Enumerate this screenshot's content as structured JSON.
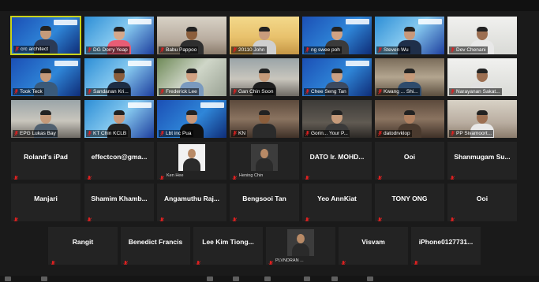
{
  "colors": {
    "background": "#1a1a1a",
    "tile": "#232323",
    "active_border": "#c9d21a",
    "muted": "#e02020"
  },
  "video_tiles": [
    {
      "name": "crc architect",
      "banner": ""
    },
    {
      "name": "DG Dorry Yeap",
      "banner": "Hi"
    },
    {
      "name": "Babu Pappoo",
      "banner": ""
    },
    {
      "name": "20110 John",
      "banner": ""
    },
    {
      "name": "ng swee poh",
      "banner": ""
    },
    {
      "name": "Steven Wu",
      "banner": ""
    },
    {
      "name": "Dev Chenani",
      "banner": ""
    },
    {
      "name": "Took Teck",
      "banner": ""
    },
    {
      "name": "Sandanan Kri...",
      "banner": "20"
    },
    {
      "name": "Frederick Lee",
      "banner": ""
    },
    {
      "name": "Gan Chin Soon",
      "banner": ""
    },
    {
      "name": "Chee Seng Tan",
      "banner": ""
    },
    {
      "name": "Kwang ... Shi...",
      "banner": ""
    },
    {
      "name": "Narayanan Sakat...",
      "banner": ""
    },
    {
      "name": "EPG Lukas Bay",
      "banner": ""
    },
    {
      "name": "KT Chin KCLB",
      "banner": "20"
    },
    {
      "name": "Lbt inc Pua",
      "banner": "20"
    },
    {
      "name": "KN",
      "banner": ""
    },
    {
      "name": "Gorin... Your P...",
      "banner": ""
    },
    {
      "name": "datodrvklop",
      "banner": ""
    },
    {
      "name": "PP Sivamoort...",
      "banner": ""
    }
  ],
  "name_tiles_row5": [
    {
      "name": "Roland's iPad",
      "photo": false
    },
    {
      "name": "effectcon@gma...",
      "photo": false
    },
    {
      "name": "Ken Hee",
      "photo": true
    },
    {
      "name": "Hening Chin",
      "photo": true
    },
    {
      "name": "DATO Ir. MOHD...",
      "photo": false
    },
    {
      "name": "Ooi",
      "photo": false
    },
    {
      "name": "Shanmugam Su...",
      "photo": false
    }
  ],
  "name_tiles_row6": [
    {
      "name": "Manjari"
    },
    {
      "name": "Shamim Khamb..."
    },
    {
      "name": "Angamuthu Raj..."
    },
    {
      "name": "Bengsooi Tan"
    },
    {
      "name": "Yeo AnnKiat"
    },
    {
      "name": "TONY ONG"
    },
    {
      "name": "Ooi"
    }
  ],
  "name_tiles_row7": [
    {
      "name": "Rangit",
      "photo": false
    },
    {
      "name": "Benedict Francis",
      "photo": false
    },
    {
      "name": "Lee Kim Tiong...",
      "photo": false
    },
    {
      "name": "PLVNDRAN ...",
      "photo": true
    },
    {
      "name": "Visvam",
      "photo": false
    },
    {
      "name": "iPhone0127731...",
      "photo": false
    }
  ],
  "toolbar_icons": [
    "mute-icon",
    "video-icon",
    "security-icon",
    "participants-icon",
    "chat-icon",
    "share-icon",
    "record-icon",
    "reactions-icon"
  ]
}
